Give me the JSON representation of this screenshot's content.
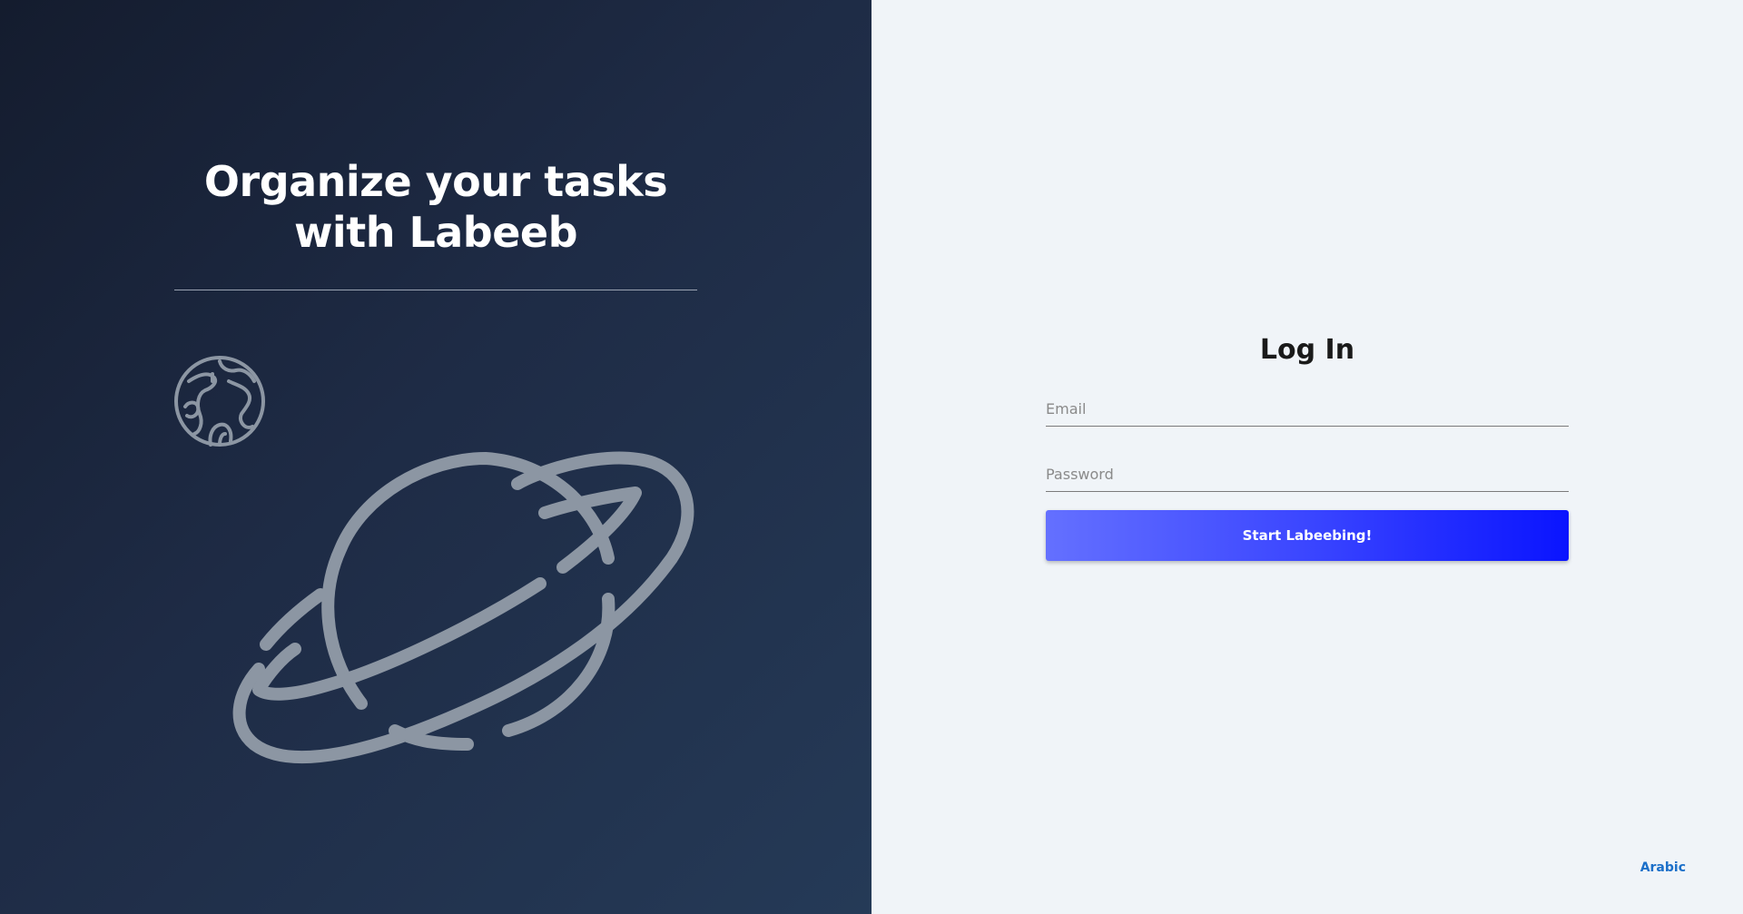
{
  "hero": {
    "headline": "Organize your tasks\nwith Labeeb",
    "icons": [
      "globe-icon",
      "planet-icon"
    ],
    "background_gradient": [
      "#141c2e",
      "#253a57"
    ],
    "icon_color": "#8c96a3"
  },
  "login": {
    "title": "Log In",
    "email_placeholder": "Email",
    "email_value": "",
    "password_placeholder": "Password",
    "password_value": "",
    "submit_label": "Start Labeebing!",
    "button_gradient": [
      "#6470ff",
      "#0a14ff"
    ]
  },
  "footer": {
    "language_link": "Arabic",
    "link_color": "#1b6fc9"
  }
}
